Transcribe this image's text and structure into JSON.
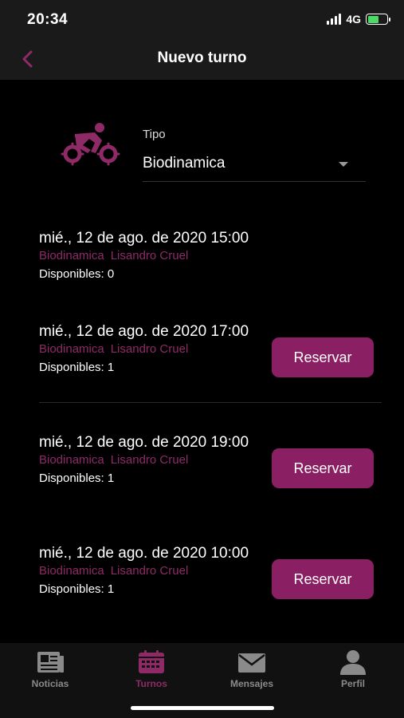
{
  "status": {
    "time": "20:34",
    "network": "4G"
  },
  "nav": {
    "title": "Nuevo turno",
    "back_icon": "chevron-left-icon"
  },
  "type_selector": {
    "label": "Tipo",
    "value": "Biodinamica",
    "icon": "cyclist-icon"
  },
  "slots": [
    {
      "date": "mié., 12 de ago. de 2020 15:00",
      "activity": "Biodinamica",
      "instructor": "Lisandro Cruel",
      "available": "Disponibles: 0",
      "button": ""
    },
    {
      "date": "mié., 12 de ago. de 2020 17:00",
      "activity": "Biodinamica",
      "instructor": "Lisandro Cruel",
      "available": "Disponibles: 1",
      "button": "Reservar"
    },
    {
      "date": "mié., 12 de ago. de 2020 19:00",
      "activity": "Biodinamica",
      "instructor": "Lisandro Cruel",
      "available": "Disponibles: 1",
      "button": "Reservar"
    },
    {
      "date": "mié., 12 de ago. de 2020 10:00",
      "activity": "Biodinamica",
      "instructor": "Lisandro Cruel",
      "available": "Disponibles: 1",
      "button": "Reservar"
    }
  ],
  "tabs": [
    {
      "label": "Noticias",
      "icon": "newspaper-icon",
      "active": false
    },
    {
      "label": "Turnos",
      "icon": "calendar-icon",
      "active": true
    },
    {
      "label": "Mensajes",
      "icon": "envelope-icon",
      "active": false
    },
    {
      "label": "Perfil",
      "icon": "user-icon",
      "active": false
    }
  ],
  "colors": {
    "accent": "#8b1f63",
    "accent_text": "#8e2a66",
    "background": "#000000",
    "bar": "#1a1a1a"
  }
}
